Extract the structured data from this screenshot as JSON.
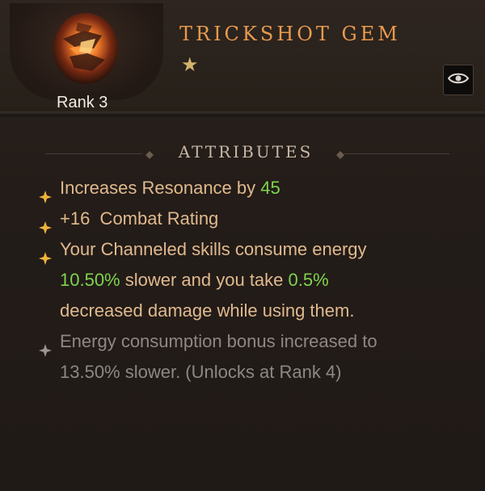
{
  "item": {
    "title": "TRICKSHOT GEM",
    "rank_label": "Rank 3",
    "stars": "★"
  },
  "section": {
    "title": "ATTRIBUTES"
  },
  "attributes": [
    {
      "prefix": "Increases Resonance by ",
      "value": "45"
    },
    {
      "value": "+16",
      "suffix": "  Combat Rating"
    },
    {
      "line1": "Your Channeled skills consume energy",
      "value1": "10.50%",
      "mid": " slower and you take ",
      "value2": "0.5%",
      "line3": "decreased damage while using them."
    },
    {
      "line1": "Energy consumption bonus increased to",
      "line2": "13.50% slower. (Unlocks at Rank 4)"
    }
  ],
  "colors": {
    "title": "#e89a4f",
    "attribute_text": "#e0b98e",
    "highlight": "#7ed44e",
    "locked_text": "#8e8883",
    "bullet_active": "#f0b23c",
    "bullet_locked": "#9a9590"
  },
  "icons": {
    "gem": "trickshot-gem-icon",
    "compare": "eye-icon",
    "star": "star-icon"
  }
}
